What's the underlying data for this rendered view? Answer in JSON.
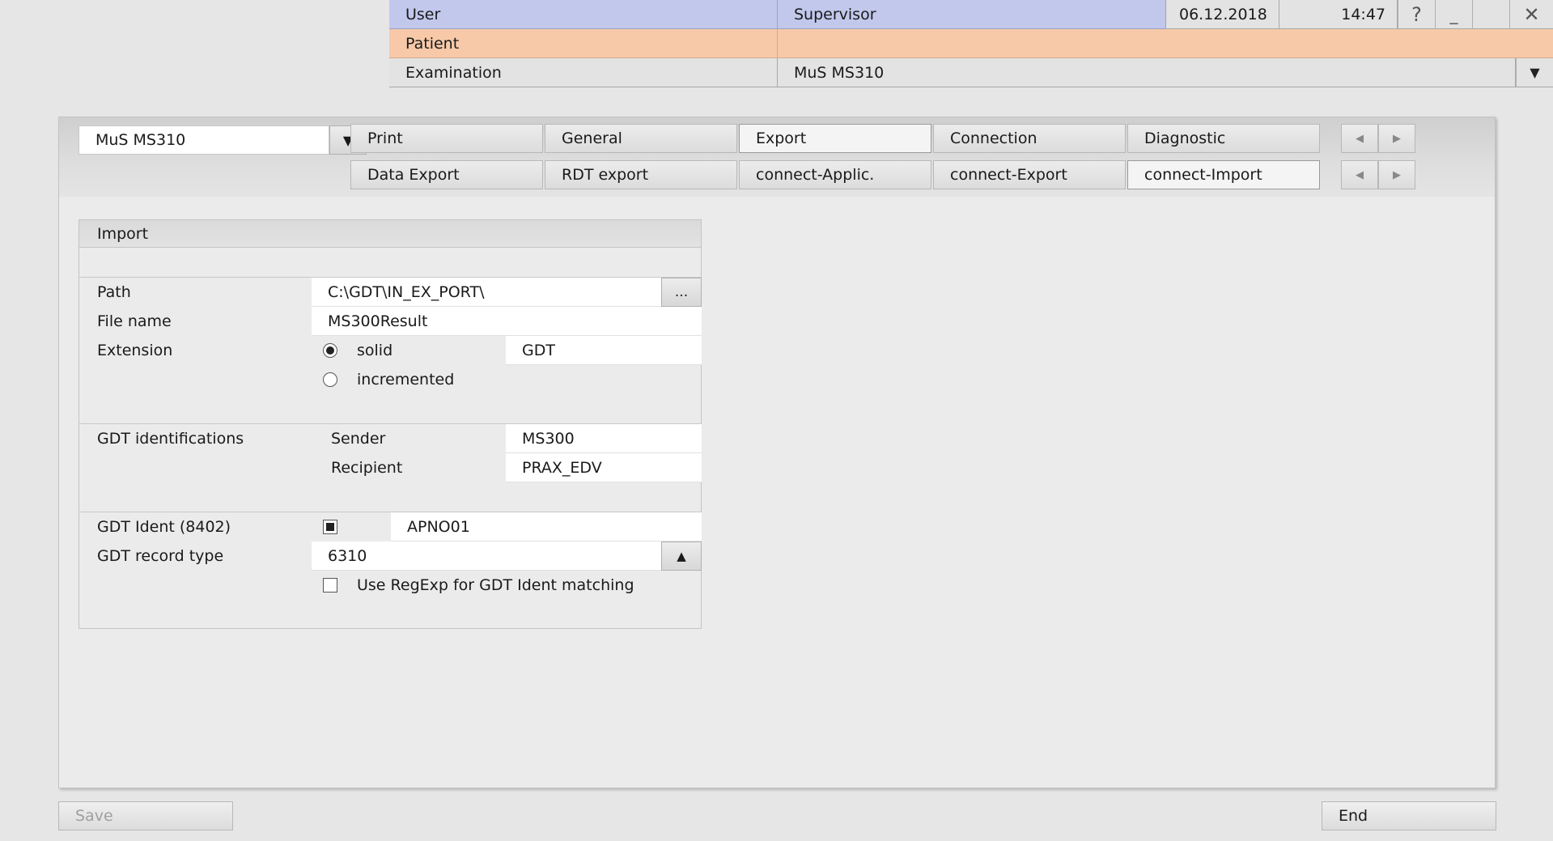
{
  "header": {
    "user_label": "User",
    "user_value": "Supervisor",
    "date": "06.12.2018",
    "time": "14:47",
    "help_icon_glyph": "?",
    "minimize_glyph": "_",
    "close_glyph": "✕",
    "patient_label": "Patient",
    "patient_value": "",
    "examination_label": "Examination",
    "examination_value": "MuS MS310",
    "dropdown_glyph": "▼"
  },
  "device_select": {
    "value": "MuS MS310",
    "dropdown_glyph": "▼"
  },
  "tabs_row1": [
    "Print",
    "General",
    "Export",
    "Connection",
    "Diagnostic"
  ],
  "tabs_row2": [
    "Data Export",
    "RDT export",
    "connect-Applic.",
    "connect-Export",
    "connect-Import"
  ],
  "tab_arrows": {
    "left": "◀",
    "right": "▶"
  },
  "import": {
    "title": "Import",
    "path_label": "Path",
    "path_value": "C:\\GDT\\IN_EX_PORT\\",
    "browse_label": "...",
    "filename_label": "File name",
    "filename_value": "MS300Result",
    "extension_label": "Extension",
    "ext_solid_label": "solid",
    "ext_solid_value": "GDT",
    "ext_incremented_label": "incremented",
    "gdt_identifications_label": "GDT identifications",
    "sender_label": "Sender",
    "sender_value": "MS300",
    "recipient_label": "Recipient",
    "recipient_value": "PRAX_EDV",
    "gdt_ident_label": "GDT Ident (8402)",
    "gdt_ident_value": "APNO01",
    "record_type_label": "GDT record type",
    "record_type_value": "6310",
    "record_type_btn_glyph": "▲",
    "regexp_label": "Use RegExp for GDT Ident matching"
  },
  "footer": {
    "save_label": "Save",
    "end_label": "End"
  },
  "colors": {
    "user_bg": "#c2c8ec",
    "patient_bg": "#f7c9a9",
    "exam_bg": "#e3e3e3"
  }
}
